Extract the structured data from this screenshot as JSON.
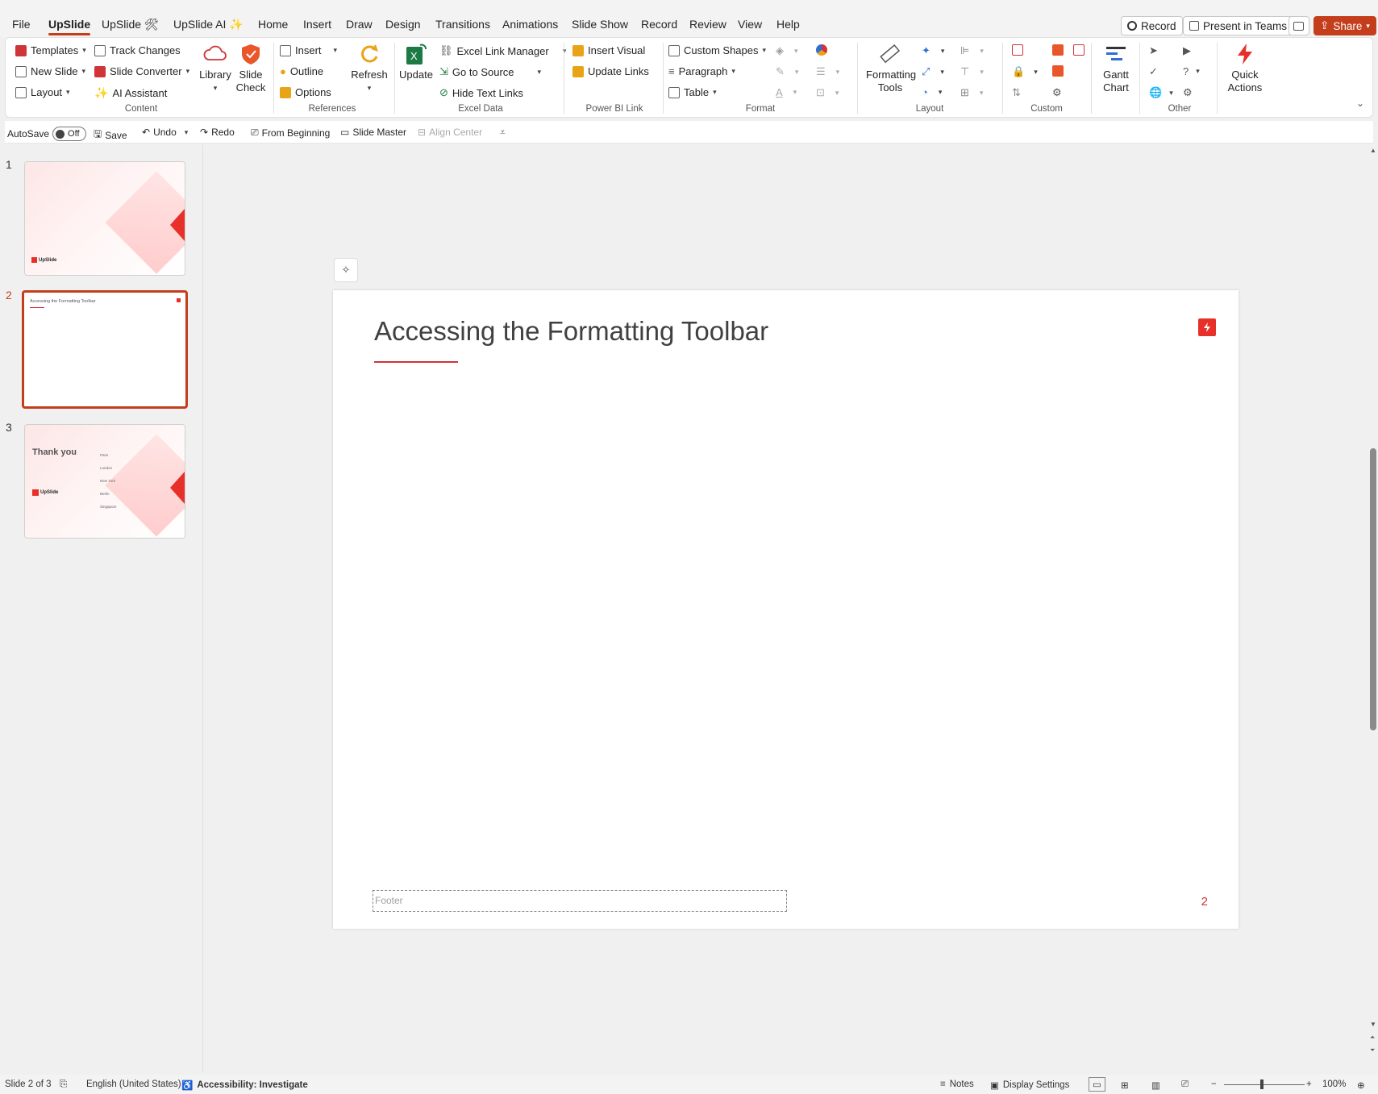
{
  "tabs": [
    "File",
    "UpSlide",
    "UpSlide 🛠",
    "UpSlide AI ✨",
    "Home",
    "Insert",
    "Draw",
    "Design",
    "Transitions",
    "Animations",
    "Slide Show",
    "Record",
    "Review",
    "View",
    "Help"
  ],
  "top_buttons": {
    "record": "Record",
    "present": "Present in Teams",
    "share": "Share"
  },
  "ribbon": {
    "content": {
      "templates": "Templates",
      "new_slide": "New Slide",
      "layout": "Layout",
      "track_changes": "Track Changes",
      "slide_converter": "Slide Converter",
      "ai_assistant": "AI Assistant",
      "library": "Library",
      "slide_check": "Slide Check",
      "label": "Content"
    },
    "references": {
      "insert": "Insert",
      "outline": "Outline",
      "options": "Options",
      "refresh": "Refresh",
      "label": "References"
    },
    "excel": {
      "update": "Update",
      "link_manager": "Excel Link Manager",
      "go_to_source": "Go to Source",
      "hide_links": "Hide Text Links",
      "label": "Excel Data"
    },
    "powerbi": {
      "insert_visual": "Insert Visual",
      "update_links": "Update Links",
      "label": "Power BI Link"
    },
    "format": {
      "custom_shapes": "Custom Shapes",
      "paragraph": "Paragraph",
      "table": "Table",
      "label": "Format"
    },
    "layout": {
      "formatting_tools": "Formatting Tools",
      "label": "Layout"
    },
    "custom": {
      "label": "Custom"
    },
    "gantt": "Gantt Chart",
    "other": {
      "label": "Other"
    },
    "quick_actions": "Quick Actions"
  },
  "qat": {
    "autosave": "AutoSave",
    "autosave_state": "Off",
    "save": "Save",
    "undo": "Undo",
    "redo": "Redo",
    "from_beginning": "From Beginning",
    "slide_master": "Slide Master",
    "align_center": "Align Center"
  },
  "thumbnails": [
    {
      "num": "1",
      "brand": "UpSlide"
    },
    {
      "num": "2",
      "title": "Accessing the Formatting Toolbar"
    },
    {
      "num": "3",
      "title": "Thank you",
      "brand": "UpSlide",
      "cities": [
        "Paris",
        "London",
        "New York",
        "Berlin",
        "Singapore"
      ]
    }
  ],
  "slide": {
    "title": "Accessing the Formatting Toolbar",
    "footer": "Footer",
    "page_number": "2"
  },
  "status": {
    "slide": "Slide 2 of 3",
    "language": "English (United States)",
    "accessibility": "Accessibility: Investigate",
    "notes": "Notes",
    "display": "Display Settings",
    "zoom": "100%"
  }
}
